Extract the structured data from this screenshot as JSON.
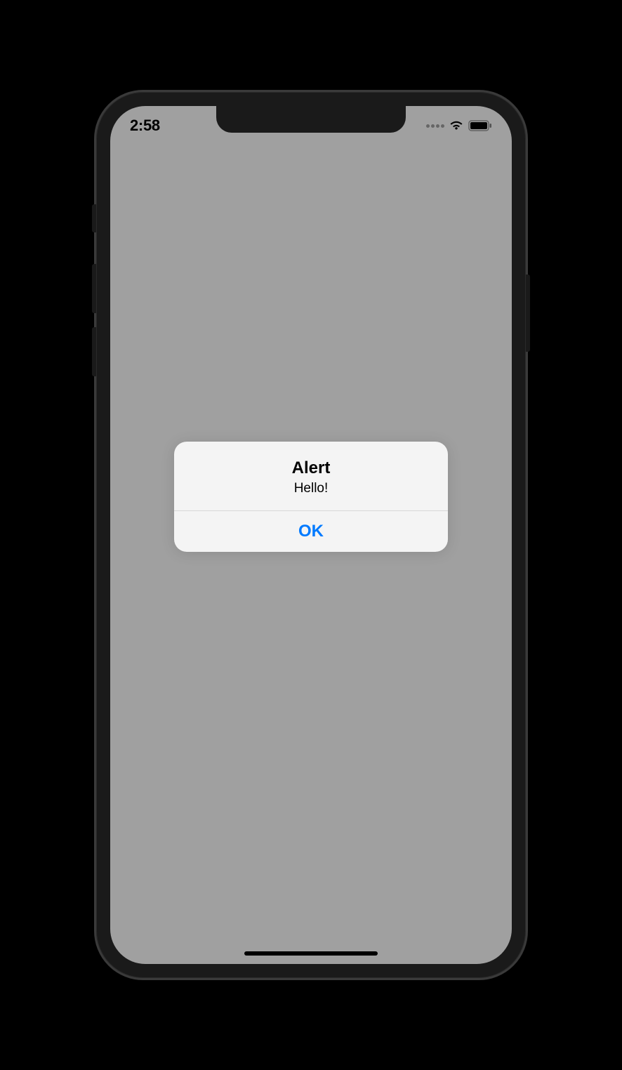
{
  "statusBar": {
    "time": "2:58"
  },
  "alert": {
    "title": "Alert",
    "message": "Hello!",
    "okLabel": "OK"
  }
}
